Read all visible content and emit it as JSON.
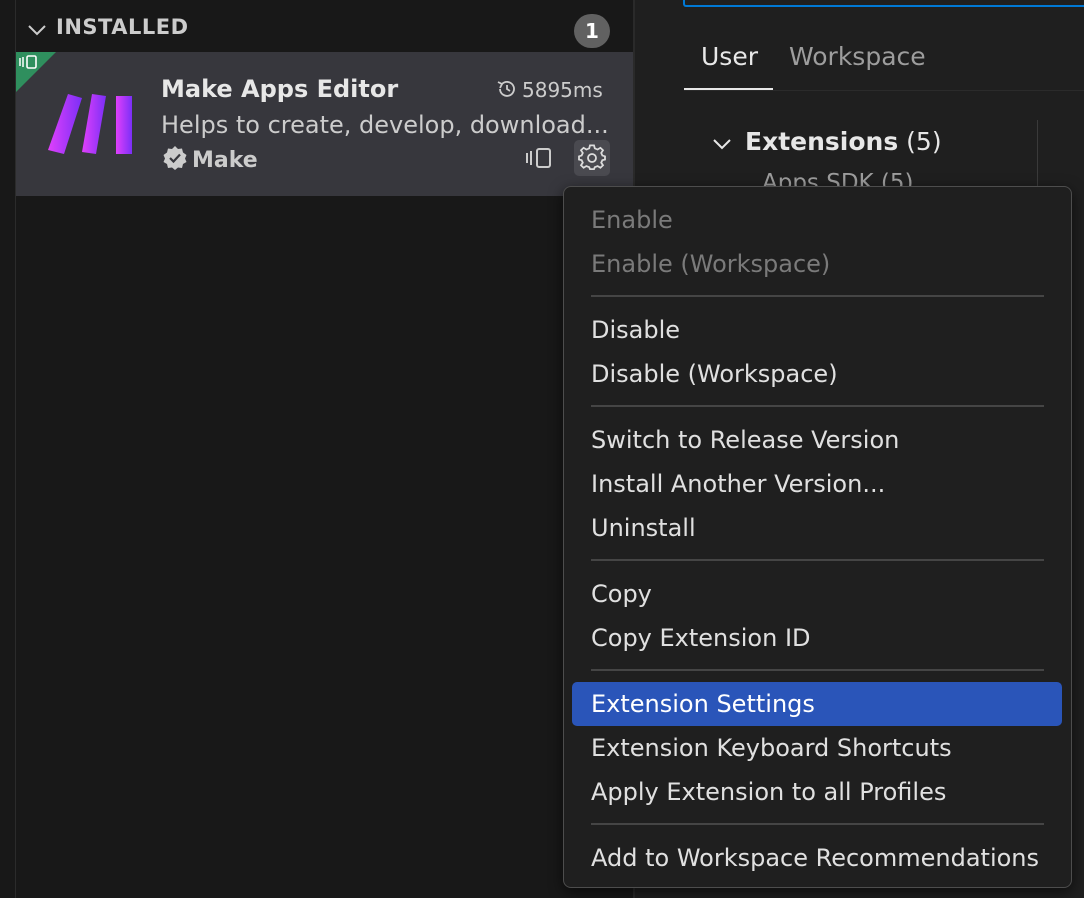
{
  "sidebar": {
    "section_title": "INSTALLED",
    "count": "1",
    "extension": {
      "name": "Make Apps Editor",
      "timing": "5895ms",
      "description": "Helps to create, develop, download...",
      "publisher": "Make"
    }
  },
  "editor": {
    "tabs": {
      "user": "User",
      "workspace": "Workspace"
    },
    "tree": {
      "group_label": "Extensions",
      "group_count": "(5)",
      "sub_label": "Apps SDK (5)"
    }
  },
  "context_menu": {
    "items": [
      {
        "label": "Enable",
        "state": "disabled"
      },
      {
        "label": "Enable (Workspace)",
        "state": "disabled"
      },
      {
        "label": "Disable",
        "state": "normal"
      },
      {
        "label": "Disable (Workspace)",
        "state": "normal"
      },
      {
        "label": "Switch to Release Version",
        "state": "normal"
      },
      {
        "label": "Install Another Version...",
        "state": "normal"
      },
      {
        "label": "Uninstall",
        "state": "normal"
      },
      {
        "label": "Copy",
        "state": "normal"
      },
      {
        "label": "Copy Extension ID",
        "state": "normal"
      },
      {
        "label": "Extension Settings",
        "state": "selected"
      },
      {
        "label": "Extension Keyboard Shortcuts",
        "state": "normal"
      },
      {
        "label": "Apply Extension to all Profiles",
        "state": "normal"
      },
      {
        "label": "Add to Workspace Recommendations",
        "state": "normal"
      }
    ]
  },
  "colors": {
    "accent": "#2a55b9",
    "focus_border": "#0078d4",
    "corner_flag": "#2f8f5e",
    "logo_gradient": [
      "#e040fb",
      "#7b2ff7"
    ]
  },
  "icons": [
    "chevron-down-icon",
    "remote-icon",
    "history-icon",
    "verified-badge-icon",
    "gear-icon",
    "make-logo-icon"
  ]
}
